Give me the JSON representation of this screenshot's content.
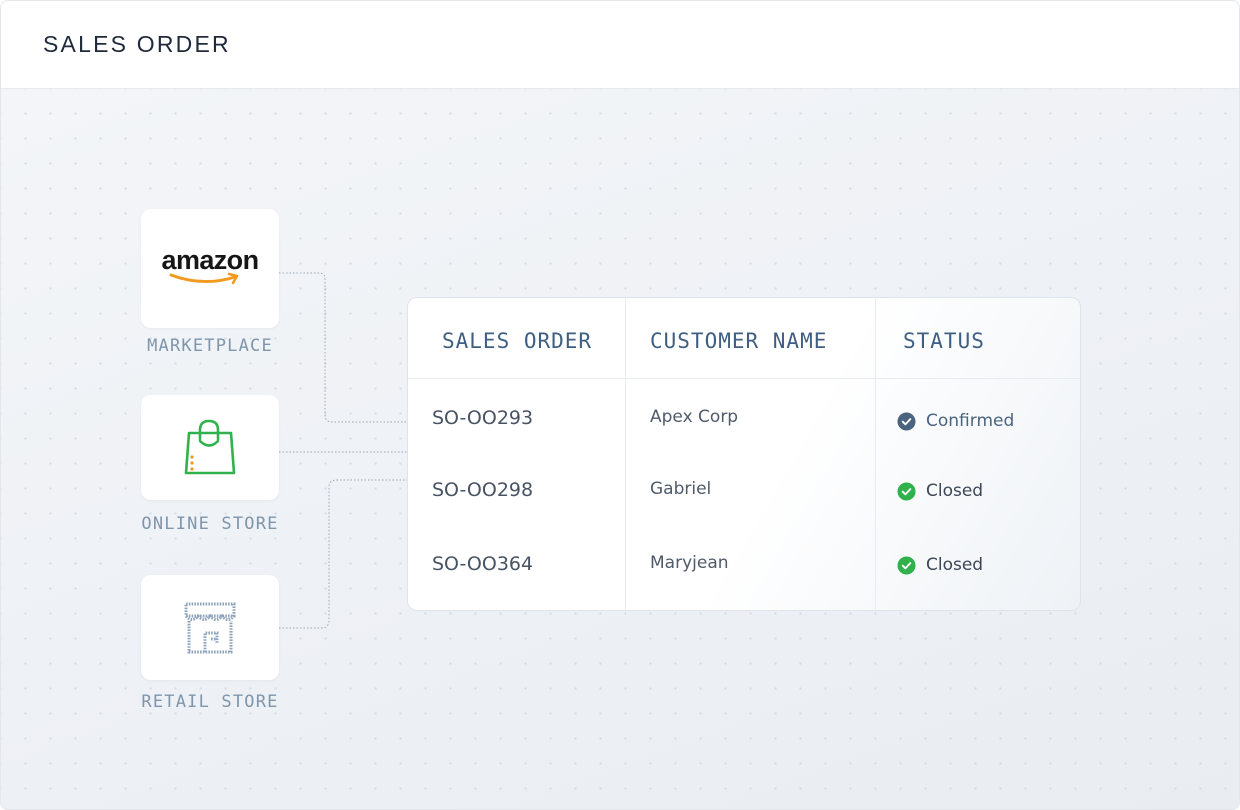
{
  "header": {
    "title": "SALES ORDER"
  },
  "sources": [
    {
      "label": "MARKETPLACE",
      "logo_text": "amazon",
      "icon": "amazon-logo"
    },
    {
      "label": "ONLINE STORE",
      "icon": "shopping-bag-icon"
    },
    {
      "label": "RETAIL STORE",
      "icon": "storefront-icon"
    }
  ],
  "table": {
    "columns": [
      "SALES ORDER",
      "CUSTOMER NAME",
      "STATUS"
    ],
    "rows": [
      {
        "order": "SO-OO293",
        "customer": "Apex Corp",
        "status": "Confirmed"
      },
      {
        "order": "SO-OO298",
        "customer": "Gabriel",
        "status": "Closed"
      },
      {
        "order": "SO-OO364",
        "customer": "Maryjean",
        "status": "Closed"
      }
    ]
  },
  "colors": {
    "confirmed": "#4a6480",
    "closed": "#2fb24c",
    "amazon_smile": "#f29a1f",
    "online_store": "#2fb24c"
  }
}
